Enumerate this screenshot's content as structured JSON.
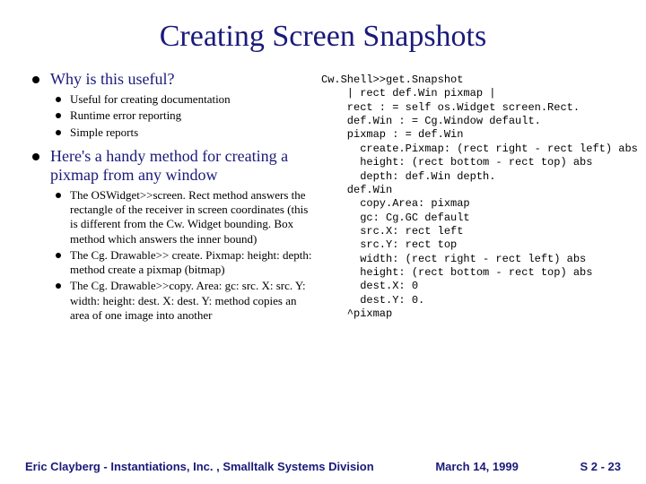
{
  "title": "Creating Screen Snapshots",
  "left": {
    "items": [
      {
        "heading": "Why is this useful?",
        "sub": [
          "Useful for creating documentation",
          "Runtime error reporting",
          "Simple reports"
        ]
      },
      {
        "heading": "Here's a handy method for creating a pixmap from any window",
        "sub": [
          "The OSWidget>>screen. Rect method answers the rectangle of the receiver in screen coordinates (this is different from the Cw. Widget bounding. Box method which answers the inner bound)",
          "The Cg. Drawable>> create. Pixmap: height: depth: method create a pixmap (bitmap)",
          "The Cg. Drawable>>copy. Area: gc: src. X: src. Y: width: height: dest. X: dest. Y: method copies an area of one image into another"
        ]
      }
    ]
  },
  "code": "Cw.Shell>>get.Snapshot\n    | rect def.Win pixmap |\n    rect : = self os.Widget screen.Rect.\n    def.Win : = Cg.Window default.\n    pixmap : = def.Win\n      create.Pixmap: (rect right - rect left) abs\n      height: (rect bottom - rect top) abs\n      depth: def.Win depth.\n    def.Win\n      copy.Area: pixmap\n      gc: Cg.GC default\n      src.X: rect left\n      src.Y: rect top\n      width: (rect right - rect left) abs\n      height: (rect bottom - rect top) abs\n      dest.X: 0\n      dest.Y: 0.\n    ^pixmap",
  "footer": {
    "left": "Eric Clayberg - Instantiations, Inc. , Smalltalk Systems Division",
    "center": "March 14, 1999",
    "right": "S 2 - 23"
  }
}
